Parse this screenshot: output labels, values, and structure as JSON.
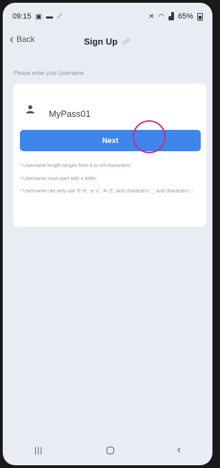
{
  "status_bar": {
    "time": "09:15",
    "battery": "65%",
    "left_icons": [
      "image-icon",
      "folder-icon",
      "wrench-icon"
    ],
    "right_icons": [
      "mute-icon",
      "wifi-icon",
      "signal-icon",
      "battery-icon"
    ]
  },
  "nav": {
    "back_label": "Back",
    "title": "Sign Up"
  },
  "form": {
    "prompt": "Please enter your Username",
    "username_value": "MyPass01",
    "next_label": "Next"
  },
  "rules": [
    "* Username length ranges from 6 to 63 characters;",
    "* Username must start with a letter;",
    "* Username can only use '0~9', 'a~z', 'A~Z', and characters '_' and characters '.'"
  ],
  "system_nav": {
    "items": [
      "recent-apps-icon",
      "home-icon",
      "back-nav-icon"
    ]
  },
  "colors": {
    "accent": "#3f86ea",
    "background": "#e9edf3",
    "card": "#ffffff",
    "tap_indicator": "#cc2a85"
  }
}
